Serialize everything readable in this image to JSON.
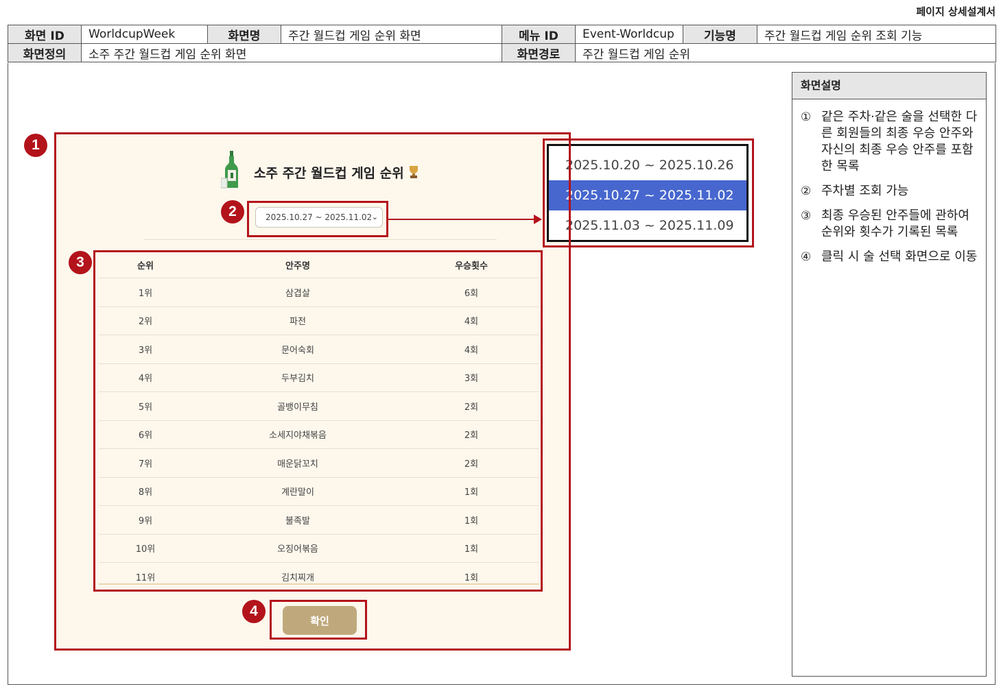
{
  "doc_title": "페이지 상세설계서",
  "header": {
    "screen_id_label": "화면 ID",
    "screen_id": "WorldcupWeek",
    "screen_name_label": "화면명",
    "screen_name": "주간 월드컵 게임 순위 화면",
    "menu_id_label": "메뉴 ID",
    "menu_id": "Event-Worldcup",
    "function_label": "기능명",
    "function_name": "주간 월드컵 게임 순위 조회 기능",
    "definition_label": "화면정의",
    "definition": "소주 주간 월드컵 게임 순위 화면",
    "path_label": "화면경로",
    "path": "주간 월드컵 게임 순위"
  },
  "description": {
    "title": "화면설명",
    "items": [
      {
        "num": "①",
        "text": "같은 주차·같은 술을 선택한 다른 회원들의 최종 우승 안주와 자신의 최종 우승 안주를 포함한 목록"
      },
      {
        "num": "②",
        "text": "주차별 조회 가능"
      },
      {
        "num": "③",
        "text": "최종 우승된 안주들에 관하여 순위와 횟수가 기록된 목록"
      },
      {
        "num": "④",
        "text": "클릭 시 술 선택 화면으로 이동"
      }
    ]
  },
  "badges": [
    "1",
    "2",
    "3",
    "4"
  ],
  "app": {
    "title": "소주 주간 월드컵 게임 순위",
    "selected_week": "2025.10.27 ~ 2025.11.02",
    "columns": [
      "순위",
      "안주명",
      "우승횟수"
    ],
    "rows": [
      [
        "1위",
        "삼겹살",
        "6회"
      ],
      [
        "2위",
        "파전",
        "4회"
      ],
      [
        "3위",
        "문어숙회",
        "4회"
      ],
      [
        "4위",
        "두부김치",
        "3회"
      ],
      [
        "5위",
        "골뱅이무침",
        "2회"
      ],
      [
        "6위",
        "소세지야채볶음",
        "2회"
      ],
      [
        "7위",
        "매운닭꼬치",
        "2회"
      ],
      [
        "8위",
        "계란말이",
        "1회"
      ],
      [
        "9위",
        "불족발",
        "1회"
      ],
      [
        "10위",
        "오징어볶음",
        "1회"
      ],
      [
        "11위",
        "김치찌개",
        "1회"
      ]
    ],
    "confirm_label": "확인"
  },
  "dropdown": {
    "options": [
      "2025.10.20 ~ 2025.10.26",
      "2025.10.27 ~ 2025.11.02",
      "2025.11.03 ~ 2025.11.09"
    ],
    "selected_index": 1
  },
  "colors": {
    "accent_red": "#b3131b",
    "app_background": "#fdf7ec",
    "button": "#bfa97c",
    "dropdown_selected": "#4767cf"
  }
}
